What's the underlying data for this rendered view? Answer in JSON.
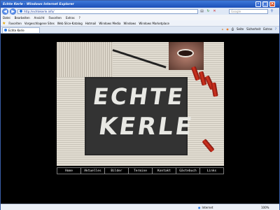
{
  "window": {
    "title": "Echte Kerle - Windows Internet Explorer"
  },
  "address_bar": {
    "url": "http://echtekerle.info/",
    "search_placeholder": "Google"
  },
  "menu": [
    "Datei",
    "Bearbeiten",
    "Ansicht",
    "Favoriten",
    "Extras",
    "?"
  ],
  "favorites_bar": {
    "label": "Favoriten",
    "items": [
      "Vorgeschlagene Sites",
      "Web Slice-Katalog",
      "Hotmail",
      "Windows Media",
      "Windows",
      "Windows Marketplace"
    ]
  },
  "tab": {
    "label": "Echte Kerle"
  },
  "toolbar": [
    "Seite",
    "Sicherheit",
    "Extras"
  ],
  "site": {
    "logo_line1": "ECHTE",
    "logo_line2": "KERLE",
    "nav": [
      "Home",
      "Aktuelles",
      "Bilder",
      "Termine",
      "Kontakt",
      "Gästebuch",
      "Links"
    ]
  },
  "status": {
    "zone": "Internet",
    "zoom": "100%"
  }
}
